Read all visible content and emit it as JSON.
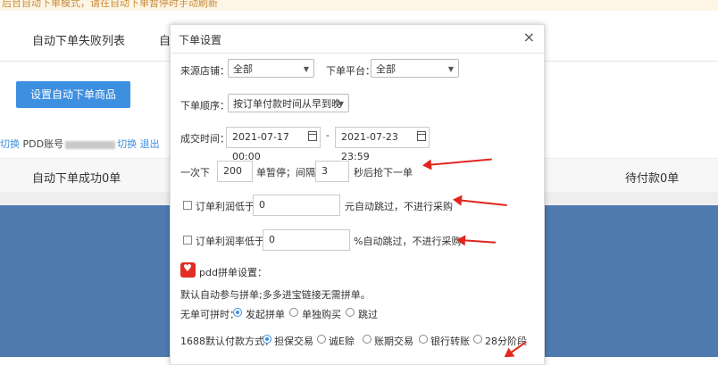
{
  "background": {
    "notice": "后台自动下单模式，请在自动下单暂停时手动刷新",
    "tab_failed": "自动下单失败列表",
    "tab_other": "自",
    "setup_button": "设置自动下单商品",
    "switch_left": "切换",
    "account_label": "PDD账号",
    "switch_right": "切换",
    "logout": "退出",
    "success_count": "自动下单成功0单",
    "pending_count": "待付款0单"
  },
  "modal": {
    "title": "下单设置",
    "close": "×",
    "store_label": "来源店铺：",
    "store_value": "全部",
    "platform_label": "下单平台：",
    "platform_value": "全部",
    "order_label": "下单顺序：",
    "order_value": "按订单付款时间从早到晚",
    "time_label": "成交时间：",
    "time_start": "2021-07-17 00:00",
    "time_dash": "-",
    "time_end": "2021-07-23 23:59",
    "batch_prefix": "一次下",
    "batch_count": "200",
    "batch_mid": "单暂停；间隔",
    "batch_interval": "3",
    "batch_suffix": "秒后抢下一单",
    "profit_label": "订单利润低于",
    "profit_value": "0",
    "profit_suffix": "元自动跳过，不进行采购",
    "margin_label": "订单利润率低于",
    "margin_value": "0",
    "margin_suffix": "%自动跳过，不进行采购",
    "pdd_title": "pdd拼单设置：",
    "pdd_desc": "默认自动参与拼单;多多进宝链接无需拼单。",
    "nogroup_label": "无单可拼时：",
    "nogroup_opts": [
      "发起拼单",
      "单独购买",
      "跳过"
    ],
    "pay_label": "1688默认付款方式：",
    "pay_opts": [
      "担保交易",
      "诚E赊",
      "账期交易",
      "银行转账",
      "28分阶段"
    ]
  },
  "colors": {
    "accent": "#3d8fe0",
    "arrow": "#e0261f",
    "pdd": "#e02e24",
    "blue_area": "#4f7ab0"
  }
}
